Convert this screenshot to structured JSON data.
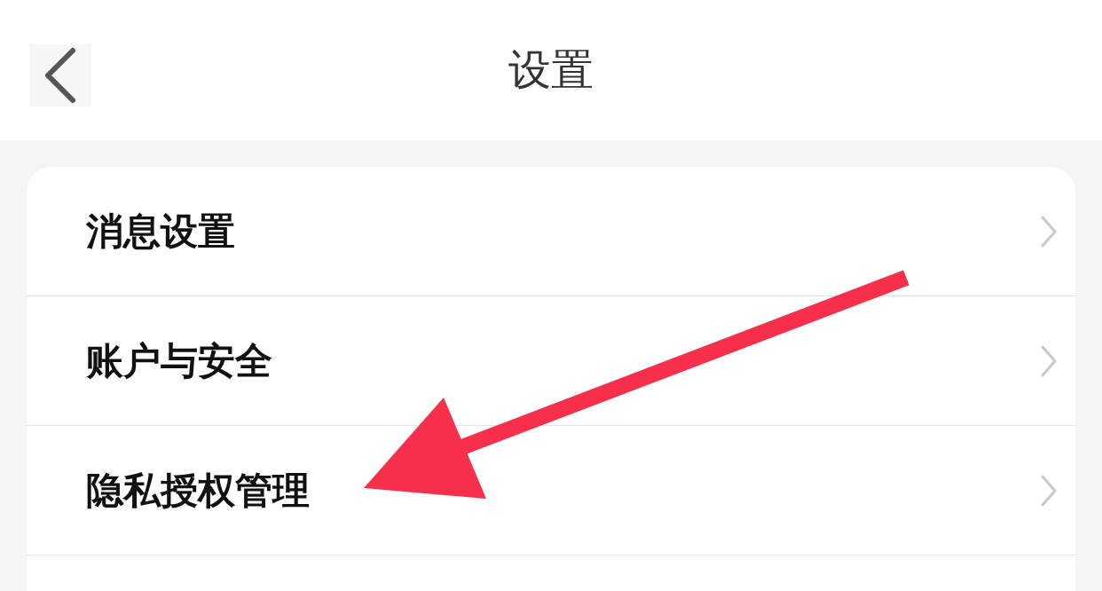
{
  "header": {
    "title": "设置"
  },
  "settings": [
    {
      "label": "消息设置"
    },
    {
      "label": "账户与安全"
    },
    {
      "label": "隐私授权管理"
    }
  ]
}
